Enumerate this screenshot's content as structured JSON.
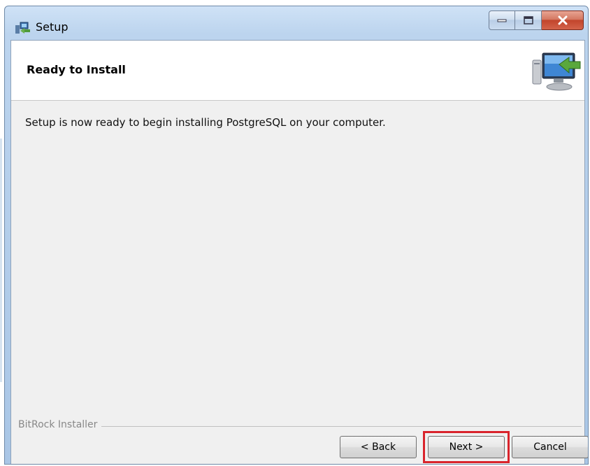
{
  "window": {
    "title": "Setup"
  },
  "title_controls": {
    "minimize": "minimize-icon",
    "maximize": "maximize-icon",
    "close": "close-icon"
  },
  "header": {
    "title": "Ready to Install",
    "icon": "installer-computer-icon"
  },
  "body": {
    "message": "Setup is now ready to begin installing PostgreSQL on your computer."
  },
  "footer": {
    "group_label": "BitRock Installer"
  },
  "buttons": {
    "back": "< Back",
    "next": "Next >",
    "cancel": "Cancel"
  },
  "colors": {
    "highlight": "#d9242c",
    "client_bg": "#f0f0f0"
  }
}
